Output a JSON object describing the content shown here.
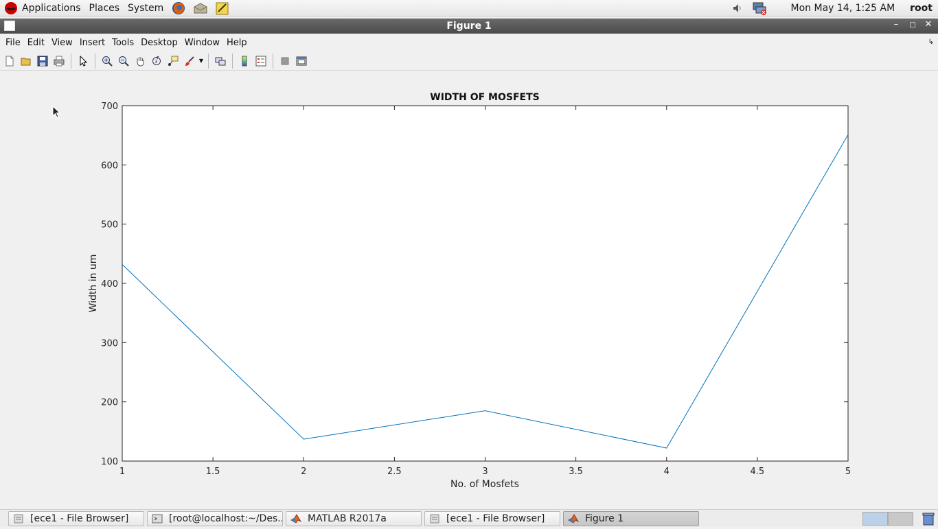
{
  "top_panel": {
    "menus": [
      "Applications",
      "Places",
      "System"
    ],
    "launchers": [
      "firefox-icon",
      "mail-icon",
      "notes-icon"
    ],
    "clock": "Mon May 14,  1:25 AM",
    "user": "root"
  },
  "window": {
    "title": "Figure 1"
  },
  "menubar": {
    "items": [
      "File",
      "Edit",
      "View",
      "Insert",
      "Tools",
      "Desktop",
      "Window",
      "Help"
    ]
  },
  "toolbar": {
    "buttons": [
      "new-figure-icon",
      "open-icon",
      "save-icon",
      "print-icon",
      "select-arrow-icon",
      "zoom-in-icon",
      "zoom-out-icon",
      "pan-hand-icon",
      "rotate-3d-icon",
      "data-cursor-icon",
      "brush-icon",
      "link-plot-icon",
      "colorbar-icon",
      "legend-icon",
      "hide-plot-tools-icon",
      "show-plot-tools-icon"
    ]
  },
  "chart_data": {
    "type": "line",
    "title": "WIDTH OF MOSFETS",
    "xlabel": "No. of Mosfets",
    "ylabel": "Width in um",
    "xlim": [
      1,
      5
    ],
    "ylim": [
      100,
      700
    ],
    "xticks": [
      "1",
      "1.5",
      "2",
      "2.5",
      "3",
      "3.5",
      "4",
      "4.5",
      "5"
    ],
    "yticks": [
      "100",
      "200",
      "300",
      "400",
      "500",
      "600",
      "700"
    ],
    "grid": false,
    "color": "#0072bd",
    "x": [
      1,
      2,
      3,
      4,
      5
    ],
    "y": [
      432,
      137,
      185,
      122,
      651
    ]
  },
  "taskbar": {
    "tasks": [
      {
        "label": "[ece1 - File Browser]",
        "icon": "file-browser-icon",
        "active": false
      },
      {
        "label": "[root@localhost:~/Des...",
        "icon": "terminal-icon",
        "active": false
      },
      {
        "label": "MATLAB R2017a",
        "icon": "matlab-icon",
        "active": false
      },
      {
        "label": "[ece1 - File Browser]",
        "icon": "file-browser-icon",
        "active": false
      },
      {
        "label": "Figure 1",
        "icon": "matlab-icon",
        "active": true
      }
    ]
  }
}
